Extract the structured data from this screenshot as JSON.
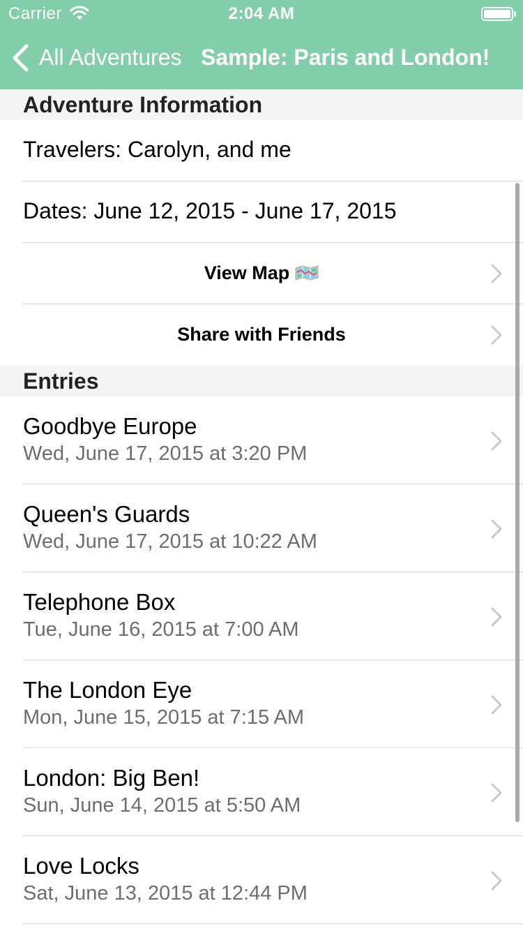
{
  "status_bar": {
    "carrier": "Carrier",
    "time": "2:04 AM"
  },
  "nav": {
    "back_label": "All Adventures",
    "title": "Sample: Paris and London!"
  },
  "colors": {
    "nav_background": "#82cdaa",
    "section_background": "#f4f4f4",
    "secondary_text": "#6d6d6d"
  },
  "info_section": {
    "header": "Adventure Information",
    "travelers": "Travelers: Carolyn, and me",
    "dates": "Dates: June 12, 2015 - June 17, 2015",
    "view_map_label": "View Map",
    "view_map_icon": "map-icon",
    "share_label": "Share with Friends"
  },
  "entries_section": {
    "header": "Entries",
    "items": [
      {
        "title": "Goodbye Europe",
        "date": "Wed, June 17, 2015 at 3:20 PM"
      },
      {
        "title": "Queen's Guards",
        "date": "Wed, June 17, 2015 at 10:22 AM"
      },
      {
        "title": "Telephone Box",
        "date": "Tue, June 16, 2015 at 7:00 AM"
      },
      {
        "title": "The London Eye",
        "date": "Mon, June 15, 2015 at 7:15 AM"
      },
      {
        "title": "London: Big Ben!",
        "date": "Sun, June 14, 2015 at 5:50 AM"
      },
      {
        "title": "Love Locks",
        "date": "Sat, June 13, 2015 at 12:44 PM"
      }
    ]
  }
}
